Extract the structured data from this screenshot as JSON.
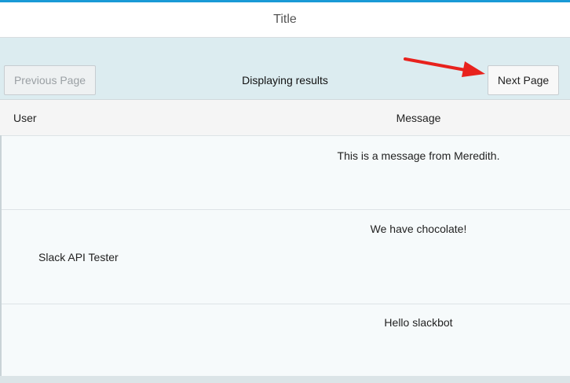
{
  "header": {
    "title": "Title"
  },
  "toolbar": {
    "previous_label": "Previous Page",
    "status_text": "Displaying results",
    "next_label": "Next Page"
  },
  "table": {
    "columns": [
      "User",
      "Message"
    ],
    "rows": [
      {
        "user": "",
        "message": "This is a message from Meredith."
      },
      {
        "user": "Slack API Tester",
        "message": "We have chocolate!"
      },
      {
        "user": "",
        "message": "Hello slackbot"
      }
    ]
  },
  "colors": {
    "accent": "#1a9ad6",
    "toolbar_bg": "#dcecf0",
    "annotation_arrow": "#e8221d"
  },
  "icons": {
    "annotation": "red-arrow-icon"
  }
}
